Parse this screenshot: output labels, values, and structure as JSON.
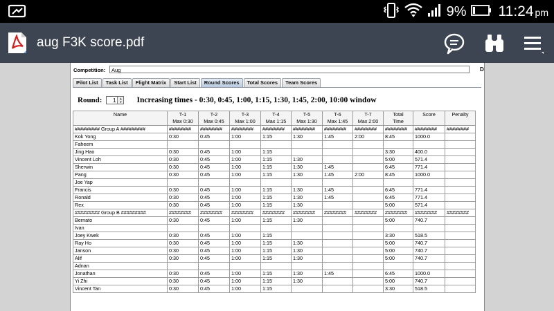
{
  "status_bar": {
    "battery_percent": "9%",
    "time": "11:24",
    "time_suffix": "pm"
  },
  "app_bar": {
    "title": "aug F3K score.pdf"
  },
  "competition": {
    "label": "Competition:",
    "value": "Aug",
    "right_letter": "D"
  },
  "tabs": [
    {
      "label": "Pilot List"
    },
    {
      "label": "Task List"
    },
    {
      "label": "Flight Matrix"
    },
    {
      "label": "Start List"
    },
    {
      "label": "Round Scores",
      "active": true
    },
    {
      "label": "Total Scores"
    },
    {
      "label": "Team Scores"
    }
  ],
  "round": {
    "label": "Round:",
    "value": "1",
    "description": "Increasing times - 0:30, 0:45, 1:00, 1:15, 1:30, 1:45, 2:00, 10:00 window"
  },
  "table": {
    "headers": [
      [
        "Name",
        ""
      ],
      [
        "T-1",
        "Max 0:30"
      ],
      [
        "T-2",
        "Max 0:45"
      ],
      [
        "T-3",
        "Max 1:00"
      ],
      [
        "T-4",
        "Max 1:15"
      ],
      [
        "T-5",
        "Max 1:30"
      ],
      [
        "T-6",
        "Max 1:45"
      ],
      [
        "T-7",
        "Max 2:00"
      ],
      [
        "Total",
        "Time"
      ],
      [
        "Score",
        ""
      ],
      [
        "Penalty",
        ""
      ]
    ],
    "rows": [
      [
        "######### Group A #########",
        "########",
        "########",
        "########",
        "########",
        "########",
        "########",
        "########",
        "########",
        "########",
        "########"
      ],
      [
        "Kok Yong",
        "0:30",
        "0:45",
        "1:00",
        "1:15",
        "1:30",
        "1:45",
        "2:00",
        "8:45",
        "1000.0",
        ""
      ],
      [
        "Faheem",
        "",
        "",
        "",
        "",
        "",
        "",
        "",
        "",
        "",
        ""
      ],
      [
        "Jing Hao",
        "0:30",
        "0:45",
        "1:00",
        "1:15",
        "",
        "",
        "",
        "3:30",
        "400.0",
        ""
      ],
      [
        "Vincent Loh",
        "0:30",
        "0:45",
        "1:00",
        "1:15",
        "1:30",
        "",
        "",
        "5:00",
        "571.4",
        ""
      ],
      [
        "Sherwin",
        "0:30",
        "0:45",
        "1:00",
        "1:15",
        "1:30",
        "1:45",
        "",
        "6:45",
        "771.4",
        ""
      ],
      [
        "Pang",
        "0:30",
        "0:45",
        "1:00",
        "1:15",
        "1:30",
        "1:45",
        "2:00",
        "8:45",
        "1000.0",
        ""
      ],
      [
        "Joe Yap",
        "",
        "",
        "",
        "",
        "",
        "",
        "",
        "",
        "",
        ""
      ],
      [
        "Francis",
        "0:30",
        "0:45",
        "1:00",
        "1:15",
        "1:30",
        "1:45",
        "",
        "6:45",
        "771.4",
        ""
      ],
      [
        "Ronald",
        "0:30",
        "0:45",
        "1:00",
        "1:15",
        "1:30",
        "1:45",
        "",
        "6:45",
        "771.4",
        ""
      ],
      [
        "Rex",
        "0:30",
        "0:45",
        "1:00",
        "1:15",
        "1:30",
        "",
        "",
        "5:00",
        "571.4",
        ""
      ],
      [
        "######### Group B #########",
        "########",
        "########",
        "########",
        "########",
        "########",
        "########",
        "########",
        "########",
        "########",
        "########"
      ],
      [
        "Bernato",
        "0:30",
        "0:45",
        "1:00",
        "1:15",
        "1:30",
        "",
        "",
        "5:00",
        "740.7",
        ""
      ],
      [
        "Ivan",
        "",
        "",
        "",
        "",
        "",
        "",
        "",
        "",
        "",
        ""
      ],
      [
        "Joey Kwek",
        "0:30",
        "0:45",
        "1:00",
        "1:15",
        "",
        "",
        "",
        "3:30",
        "518.5",
        ""
      ],
      [
        "Ray Ho",
        "0:30",
        "0:45",
        "1:00",
        "1:15",
        "1:30",
        "",
        "",
        "5:00",
        "740.7",
        ""
      ],
      [
        "Janson",
        "0:30",
        "0:45",
        "1:00",
        "1:15",
        "1:30",
        "",
        "",
        "5:00",
        "740.7",
        ""
      ],
      [
        "Alif",
        "0:30",
        "0:45",
        "1:00",
        "1:15",
        "1:30",
        "",
        "",
        "5:00",
        "740.7",
        ""
      ],
      [
        "Adnan",
        "",
        "",
        "",
        "",
        "",
        "",
        "",
        "",
        "",
        ""
      ],
      [
        "Jonathan",
        "0:30",
        "0:45",
        "1:00",
        "1:15",
        "1:30",
        "1:45",
        "",
        "6:45",
        "1000.0",
        ""
      ],
      [
        "Yi Zhi",
        "0:30",
        "0:45",
        "1:00",
        "1:15",
        "1:30",
        "",
        "",
        "5:00",
        "740.7",
        ""
      ],
      [
        "Vincent Tan",
        "0:30",
        "0:45",
        "1:00",
        "1:15",
        "",
        "",
        "",
        "3:30",
        "518.5",
        ""
      ]
    ]
  },
  "colors": {
    "app_bar": "#3e4552",
    "pdf_red": "#d2201f",
    "active_tab": "#b8cbe0"
  },
  "icons": [
    "screen-cast-icon",
    "vibrate-icon",
    "wifi-icon",
    "signal-icon",
    "battery-icon",
    "pdf-file-icon",
    "comment-icon",
    "binoculars-icon",
    "menu-icon"
  ]
}
